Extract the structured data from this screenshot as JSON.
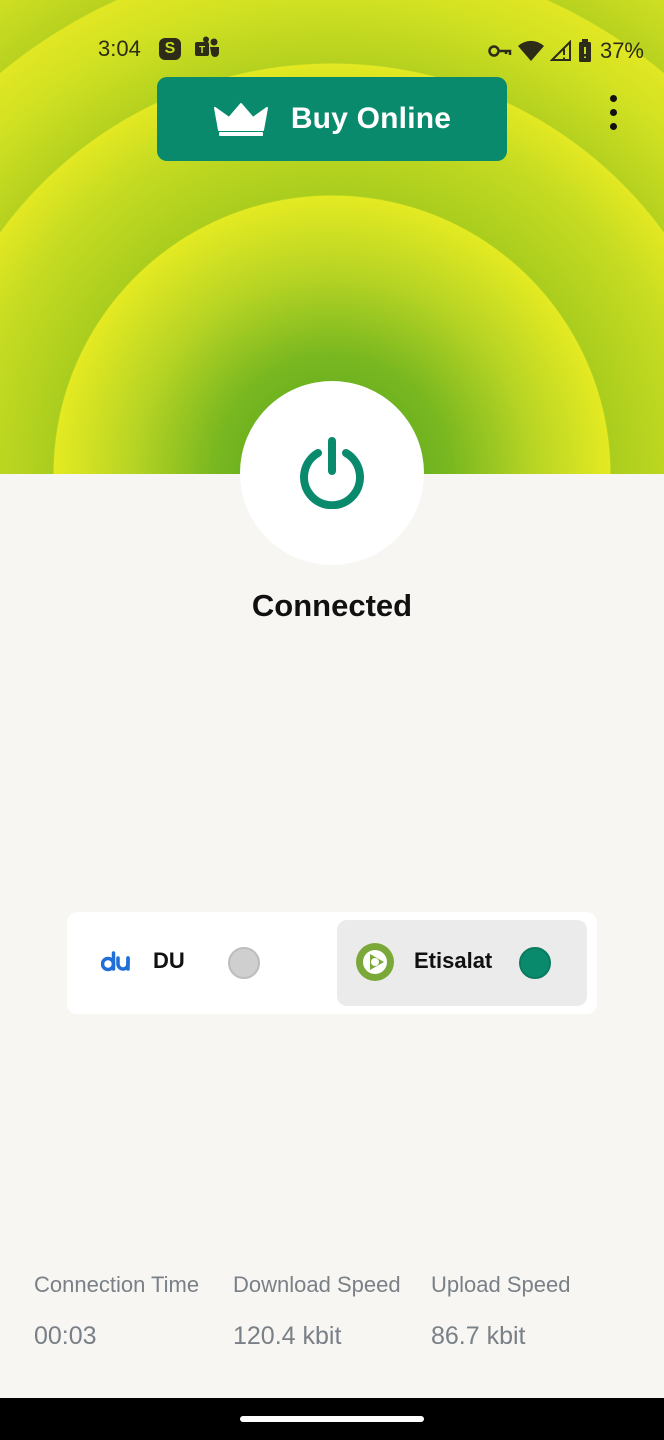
{
  "status_bar": {
    "time": "3:04",
    "app_icons": [
      "skype-icon",
      "teams-icon"
    ],
    "battery_percent": "37%",
    "indicators": [
      "vpn-key-icon",
      "wifi-icon",
      "signal-icon",
      "battery-icon"
    ]
  },
  "header": {
    "buy_label": "Buy Online",
    "buy_icon": "crown-icon",
    "menu_icon": "more-vert-icon"
  },
  "power": {
    "icon": "power-icon",
    "status": "Connected"
  },
  "networks": [
    {
      "label": "DU",
      "logo": "du-logo",
      "selected": false
    },
    {
      "label": "Etisalat",
      "logo": "etisalat-logo",
      "selected": true
    }
  ],
  "stats": [
    {
      "label": "Connection Time",
      "value": "00:03"
    },
    {
      "label": "Download Speed",
      "value": "120.4 kbit"
    },
    {
      "label": "Upload Speed",
      "value": "86.7 kbit"
    }
  ],
  "colors": {
    "accent": "#0a8a6c",
    "hero_inner": "#4ea21f",
    "hero_outer": "#e4ea22",
    "background": "#f7f6f2"
  }
}
